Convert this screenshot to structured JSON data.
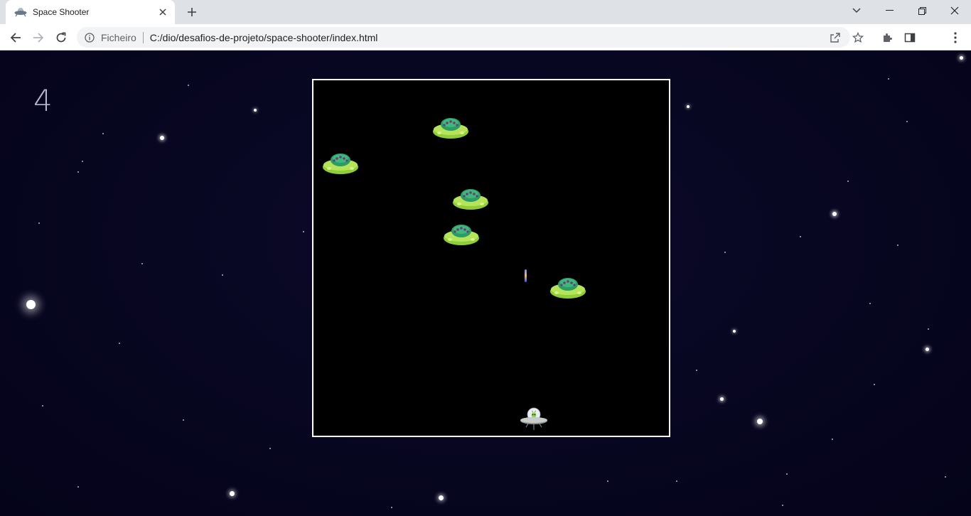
{
  "browser": {
    "tab_title": "Space Shooter",
    "site_info_label": "Ficheiro",
    "url": "C:/dio/desafios-de-projeto/space-shooter/index.html"
  },
  "game": {
    "score": "4",
    "enemy_count": 5,
    "icons": {
      "player": "ufo-player-icon",
      "enemy": "alien-saucer-icon",
      "shot": "laser-shot"
    }
  }
}
